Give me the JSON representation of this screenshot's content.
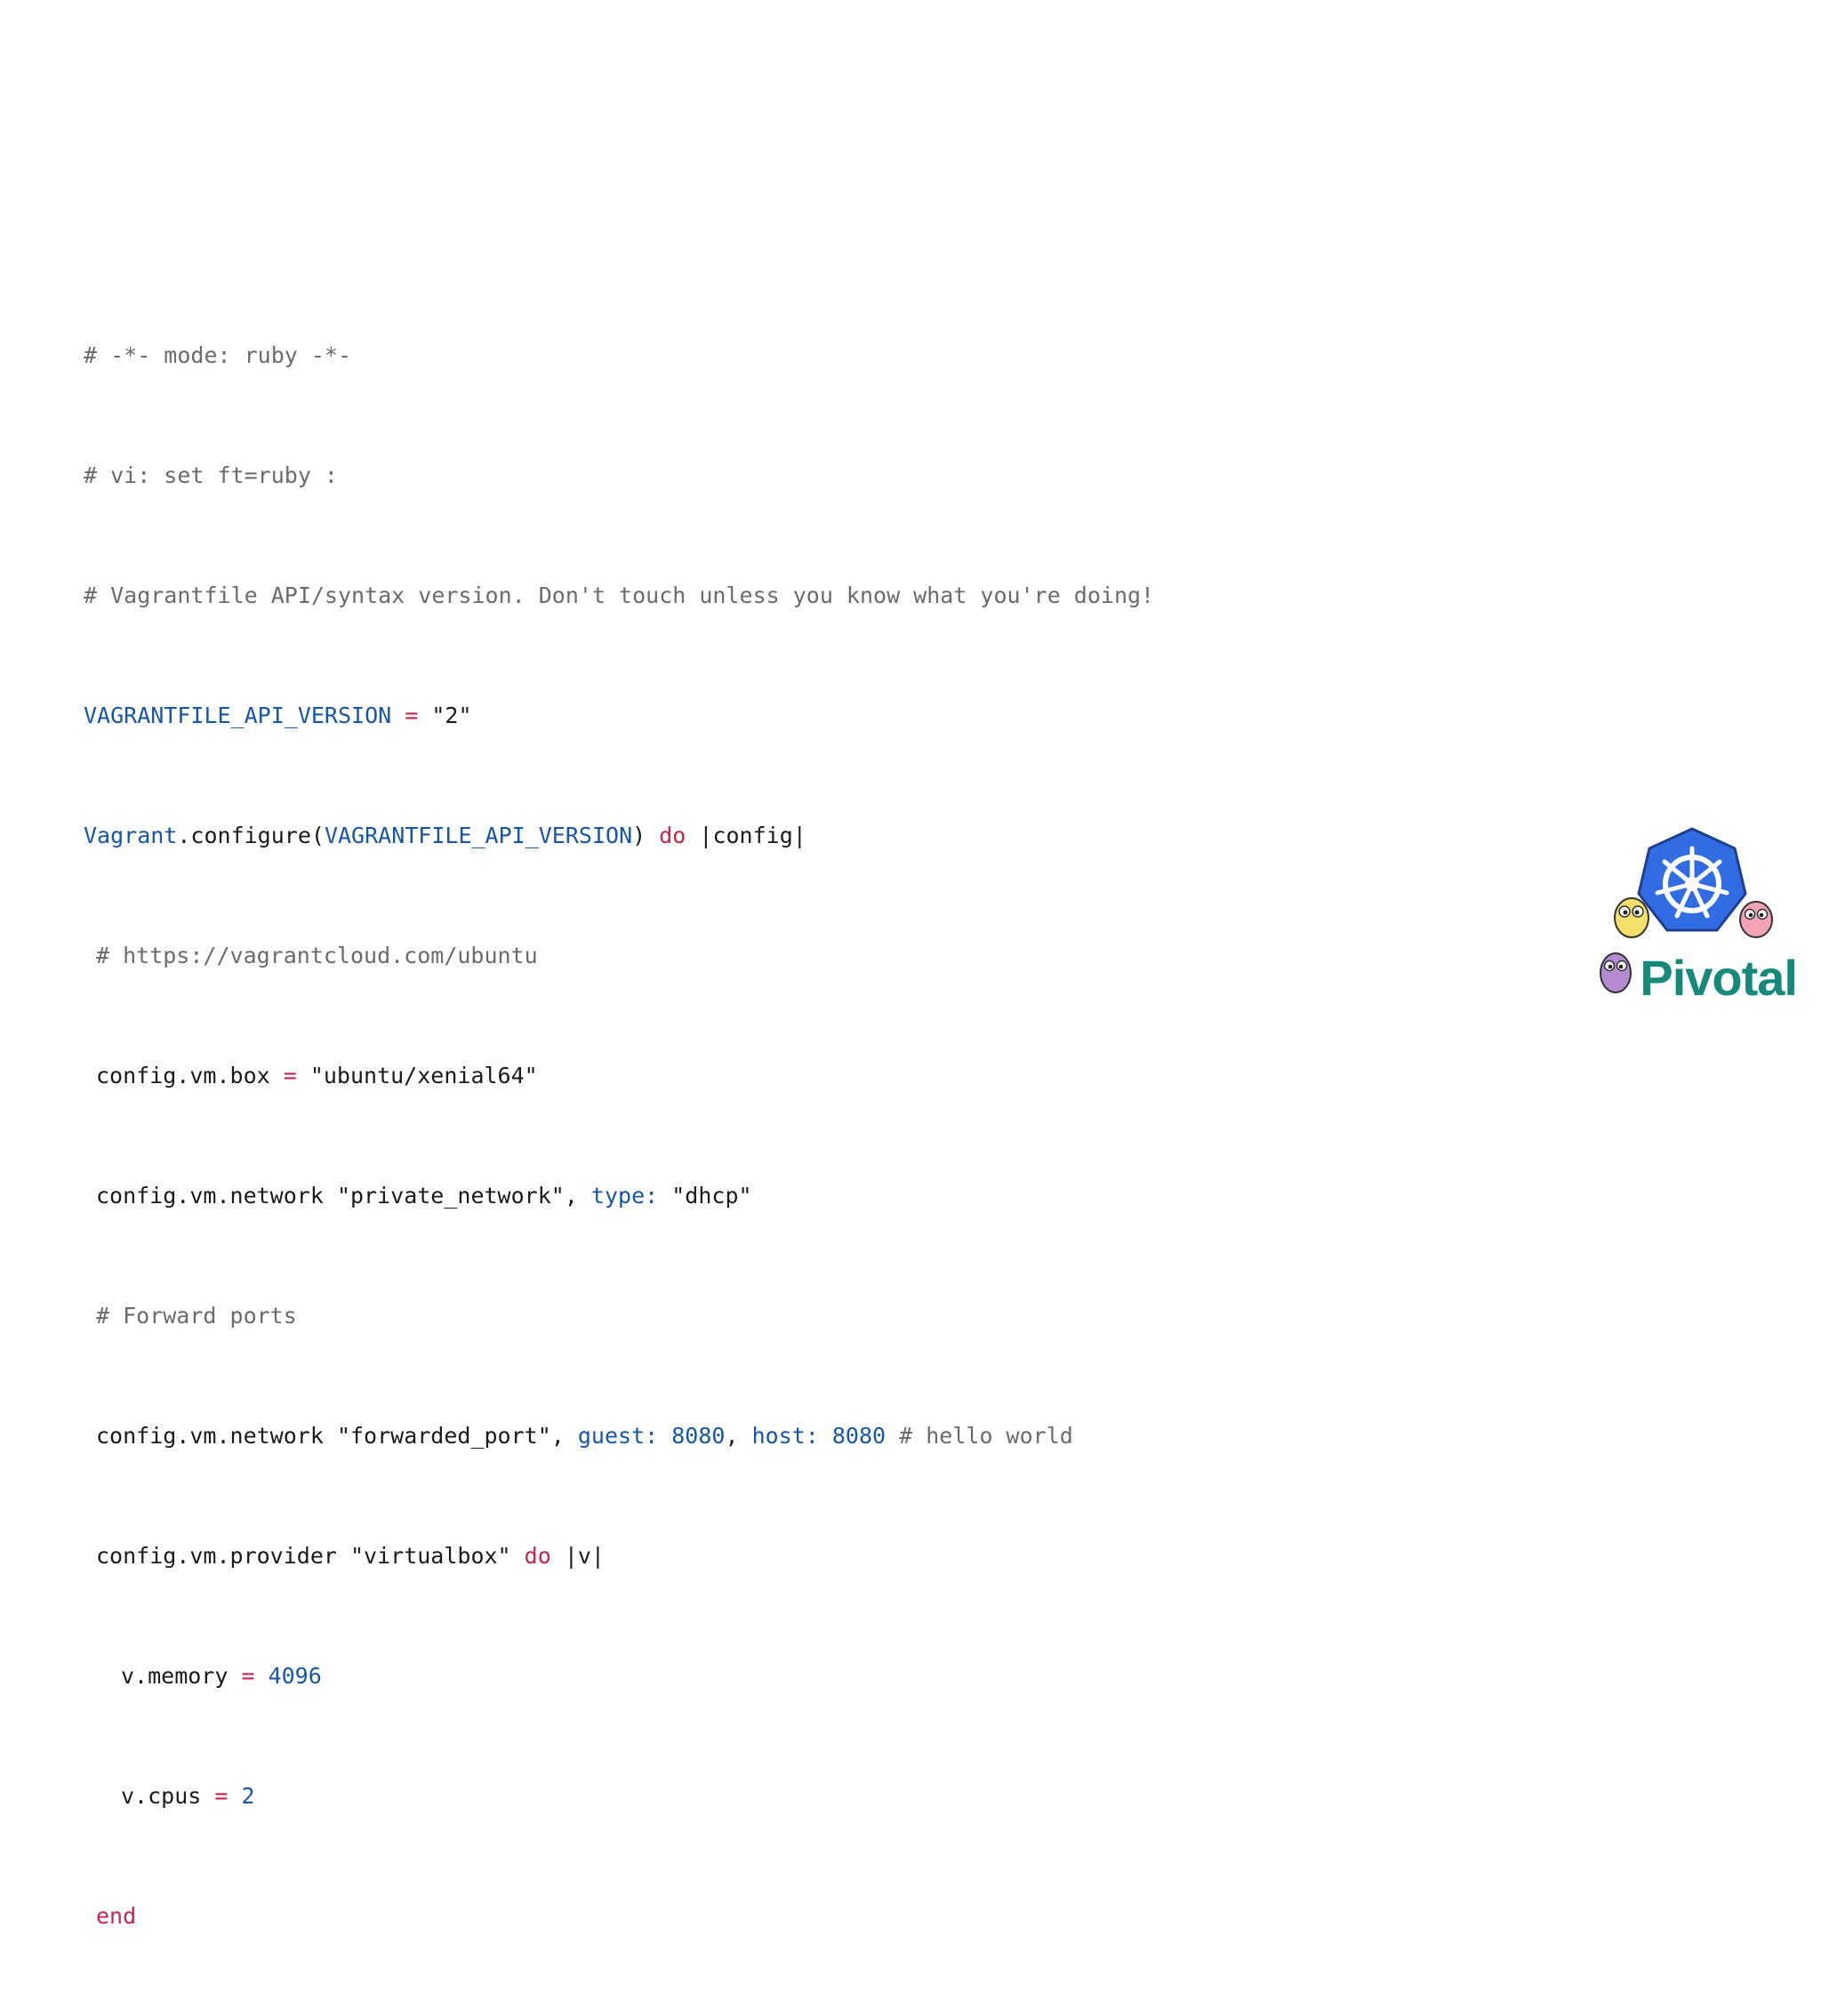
{
  "code": {
    "line1": "# -*- mode: ruby -*-",
    "line2": "# vi: set ft=ruby :",
    "line3": "# Vagrantfile API/syntax version. Don't touch unless you know what you're doing!",
    "line4": {
      "const": "VAGRANTFILE_API_VERSION",
      "op": " = ",
      "str": "\"2\""
    },
    "line5": {
      "obj": "Vagrant",
      "method": ".configure(",
      "const": "VAGRANTFILE_API_VERSION",
      "close": ") ",
      "kw": "do",
      "block": " |config|"
    },
    "line6": "# https://vagrantcloud.com/ubuntu",
    "line7": {
      "target": "config.vm.box",
      "op": " = ",
      "str": "\"ubuntu/xenial64\""
    },
    "line8": {
      "target": "config.vm.network ",
      "str1": "\"private_network\"",
      "sep": ", ",
      "sym": "type:",
      "sp": " ",
      "str2": "\"dhcp\""
    },
    "line9": "# Forward ports",
    "line10": {
      "target": "config.vm.network ",
      "str1": "\"forwarded_port\"",
      "sep1": ", ",
      "sym1": "guest:",
      "num1": " 8080",
      "sep2": ", ",
      "sym2": "host:",
      "num2": " 8080",
      "comment": " # hello world"
    },
    "line11": {
      "target": "config.vm.provider ",
      "str": "\"virtualbox\"",
      "sp": " ",
      "kw": "do",
      "block": " |v|"
    },
    "line12": {
      "target": "v.memory",
      "op": " = ",
      "num": "4096"
    },
    "line13": {
      "target": "v.cpus",
      "op": " = ",
      "num": "2"
    },
    "line14": "end"
  },
  "logo": {
    "text": "Pivotal",
    "icon": "kubernetes-wheel-icon",
    "mascots": [
      "gopher-yellow-icon",
      "gopher-purple-icon",
      "gopher-pink-icon"
    ]
  },
  "colors": {
    "comment": "#6b6b6b",
    "constant": "#1556a8",
    "keyword": "#c7254e",
    "pivotal": "#168a7a",
    "kubernetes": "#326ce5"
  }
}
